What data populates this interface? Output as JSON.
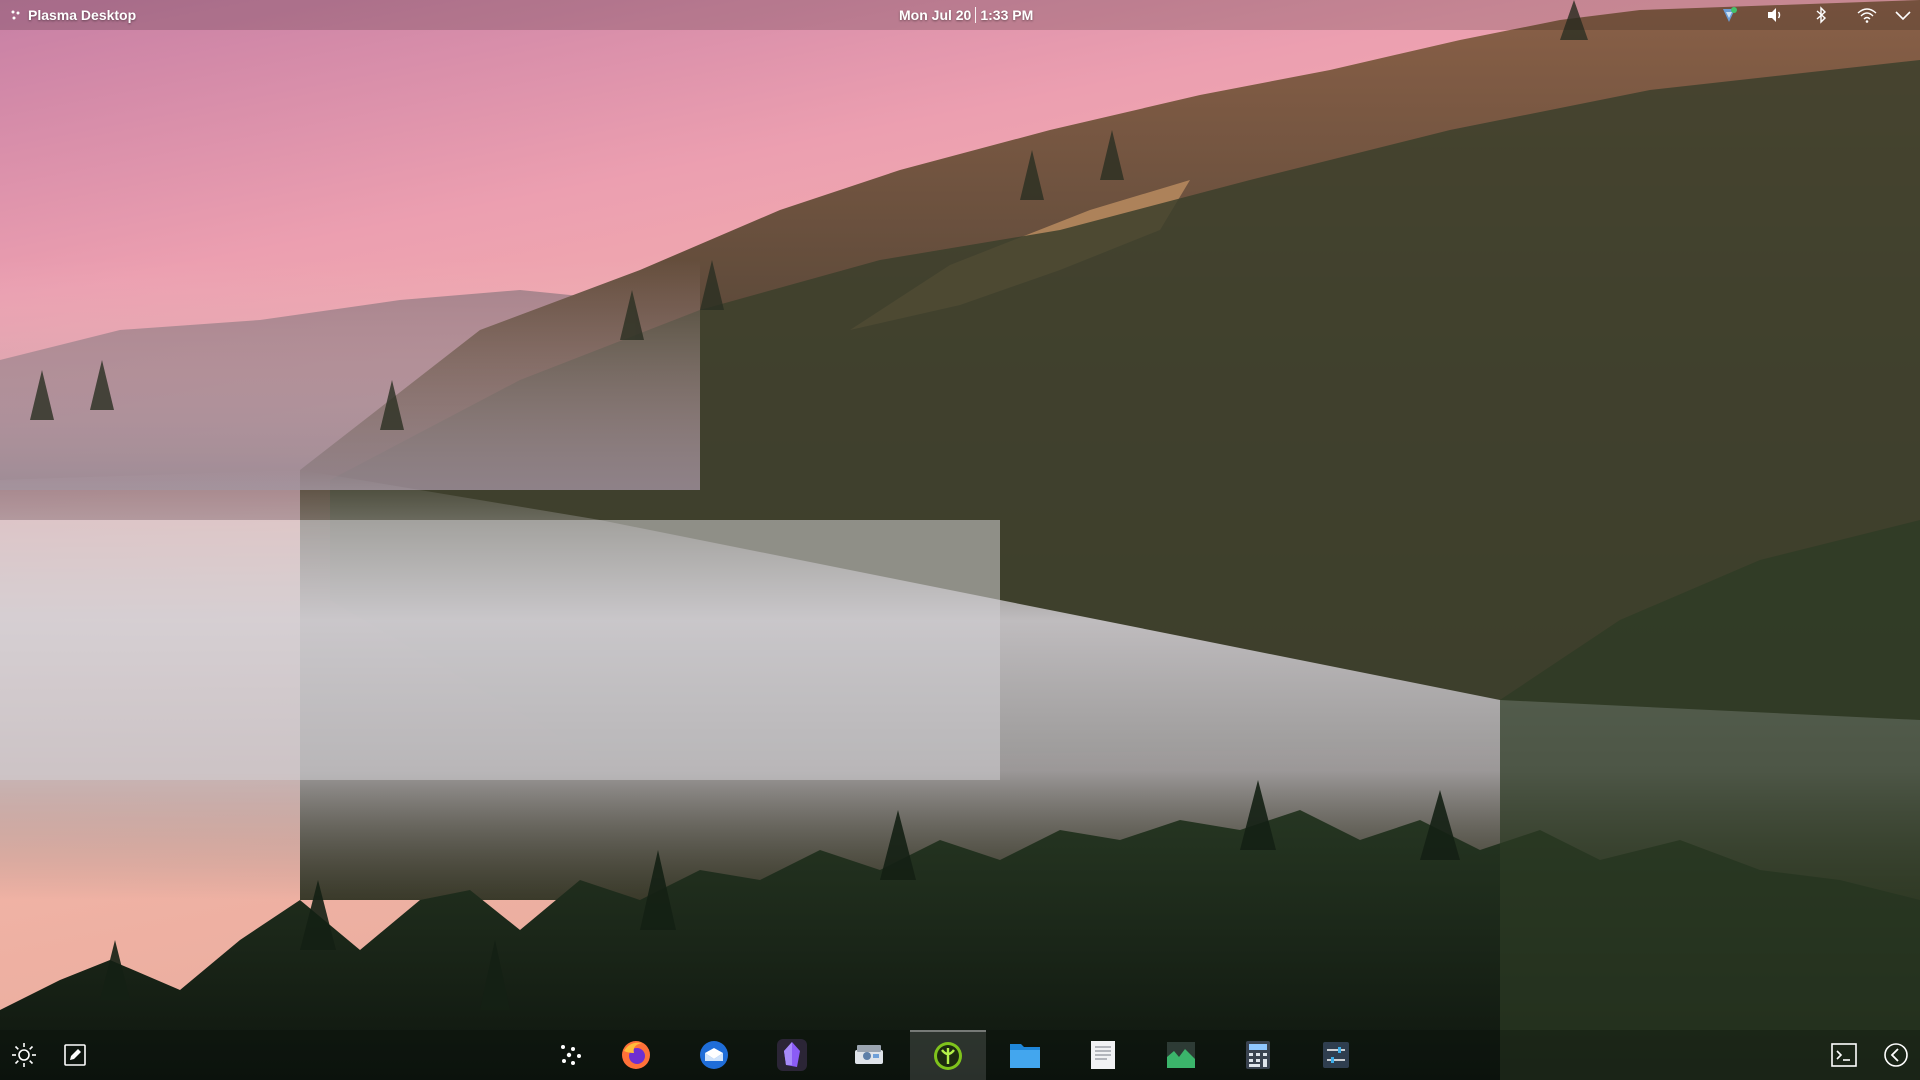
{
  "top_panel": {
    "activity_label": "Plasma Desktop",
    "clock_date": "Mon Jul 20",
    "clock_time": "1:33 PM",
    "tray_icons": [
      "vpn-shield-icon",
      "volume-icon",
      "bluetooth-icon",
      "wifi-icon",
      "expand-tray-icon"
    ]
  },
  "bottom_panel": {
    "left_widgets": [
      "brightness-icon",
      "notes-icon"
    ],
    "launchers": [
      "app-launcher-icon",
      "firefox-icon",
      "thunderbird-icon",
      "obsidian-icon",
      "scanner-icon",
      "kde-connect-icon",
      "file-manager-icon",
      "text-editor-icon",
      "system-monitor-icon",
      "calculator-icon",
      "settings-icon"
    ],
    "active_launcher": "kde-connect-icon",
    "right_widgets": [
      "terminal-icon",
      "back-icon"
    ]
  },
  "colors": {
    "sky_top": "#c47fa0",
    "sky_horizon": "#f4b7aa",
    "forest_dark": "#1f2a1c",
    "fog": "#c9c4cc",
    "accent_green": "#7fc31c"
  }
}
